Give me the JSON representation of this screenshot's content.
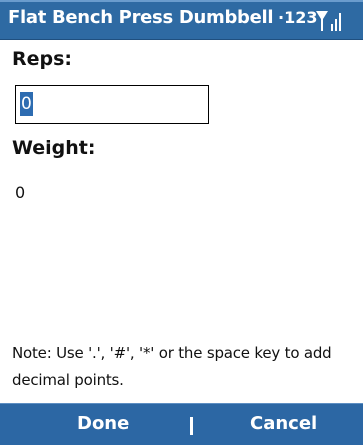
{
  "window": {
    "title": "Flat Bench Press Dumbbell",
    "status_text": "·123",
    "status_icon": "signal-strength-icon"
  },
  "form": {
    "reps_label": "Reps:",
    "reps_value": "0",
    "weight_label": "Weight:",
    "weight_value": "0"
  },
  "note": {
    "text": "Note: Use '.', '#', '*' or the space key to add decimal points."
  },
  "softkeys": {
    "done_label": "Done",
    "cancel_label": "Cancel"
  },
  "colors": {
    "title_bar": "#2e6aa3",
    "softkey_bar": "#2c67a4",
    "selection": "#2d6cb1"
  }
}
